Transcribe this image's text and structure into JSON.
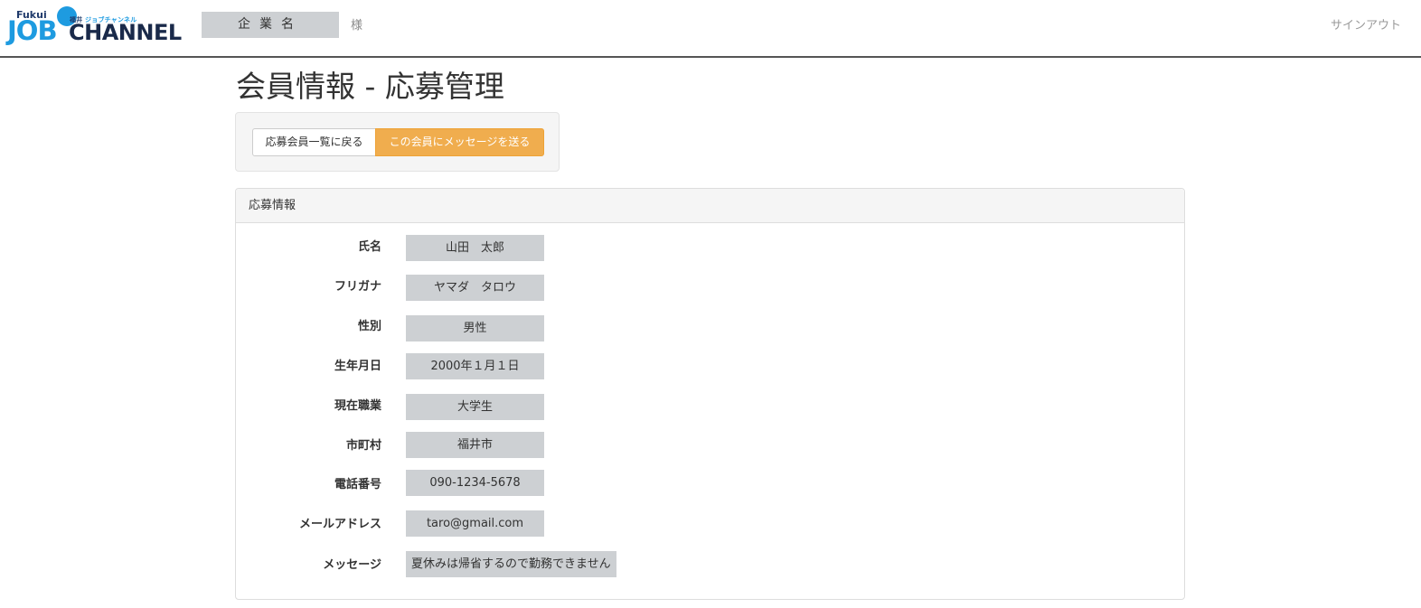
{
  "header": {
    "logo": {
      "fukui": "Fukui",
      "tagline_a": "福井",
      "tagline_b": "ジョブチャンネル",
      "job": "JOB",
      "channel": "CHANNEL"
    },
    "company_name": "企業名",
    "honorific": "様",
    "signout_label": "サインアウト"
  },
  "page": {
    "title": "会員情報 - 応募管理"
  },
  "actions": {
    "back_label": "応募会員一覧に戻る",
    "message_label": "この会員にメッセージを送る"
  },
  "panel": {
    "heading": "応募情報",
    "fields": [
      {
        "label": "氏名",
        "value": "山田　太郎"
      },
      {
        "label": "フリガナ",
        "value": "ヤマダ　タロウ"
      },
      {
        "label": "性別",
        "value": "男性"
      },
      {
        "label": "生年月日",
        "value": "2000年１月１日"
      },
      {
        "label": "現在職業",
        "value": "大学生"
      },
      {
        "label": "市町村",
        "value": "福井市"
      },
      {
        "label": "電話番号",
        "value": "090-1234-5678"
      },
      {
        "label": "メールアドレス",
        "value": "taro@gmail.com"
      },
      {
        "label": "メッセージ",
        "value": "夏休みは帰省するので勤務できません"
      }
    ]
  },
  "colors": {
    "accent_orange": "#f0ad4e",
    "brand_blue": "#1e9be0",
    "brand_navy": "#1a2a4a",
    "value_bg": "#cdd0d3"
  }
}
